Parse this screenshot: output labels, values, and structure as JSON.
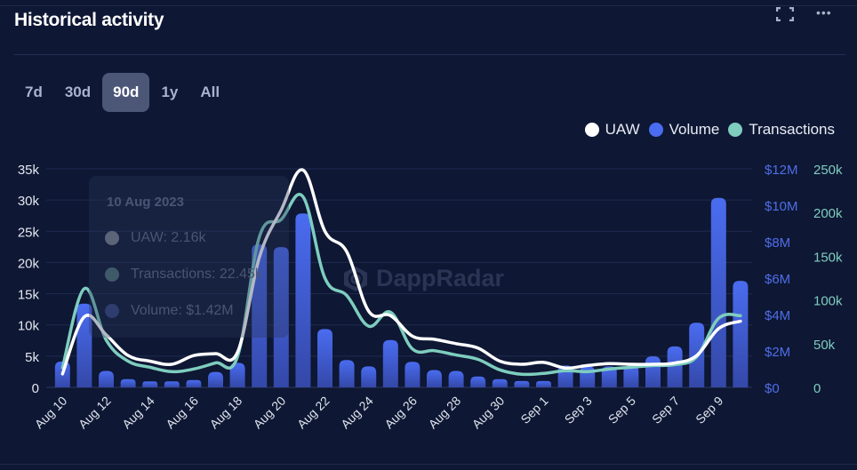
{
  "header": {
    "title": "Historical activity",
    "expand_icon": "expand-icon",
    "more_icon": "more-horizontal-icon"
  },
  "tabs": [
    {
      "label": "7d",
      "active": false
    },
    {
      "label": "30d",
      "active": false
    },
    {
      "label": "90d",
      "active": true
    },
    {
      "label": "1y",
      "active": false
    },
    {
      "label": "All",
      "active": false
    }
  ],
  "legend": [
    {
      "label": "UAW",
      "color": "#ffffff"
    },
    {
      "label": "Volume",
      "color": "#4a6cf0"
    },
    {
      "label": "Transactions",
      "color": "#7ecdbf"
    }
  ],
  "tooltip": {
    "date": "10 Aug 2023",
    "uaw": "UAW: 2.16k",
    "transactions": "Transactions: 22.45k",
    "volume": "Volume: $1.42M"
  },
  "watermark": "DappRadar",
  "chart_data": {
    "type": "bar+line",
    "categories": [
      "Aug 10",
      "Aug 11",
      "Aug 12",
      "Aug 13",
      "Aug 14",
      "Aug 15",
      "Aug 16",
      "Aug 17",
      "Aug 18",
      "Aug 19",
      "Aug 20",
      "Aug 21",
      "Aug 22",
      "Aug 23",
      "Aug 24",
      "Aug 25",
      "Aug 26",
      "Aug 27",
      "Aug 28",
      "Aug 29",
      "Aug 30",
      "Aug 31",
      "Sep 1",
      "Sep 2",
      "Sep 3",
      "Sep 4",
      "Sep 5",
      "Sep 6",
      "Sep 7",
      "Sep 8",
      "Sep 9",
      "Sep 10"
    ],
    "x_tick_labels": [
      "Aug 10",
      "Aug 12",
      "Aug 14",
      "Aug 16",
      "Aug 18",
      "Aug 20",
      "Aug 22",
      "Aug 24",
      "Aug 26",
      "Aug 28",
      "Aug 30",
      "Sep 1",
      "Sep 3",
      "Sep 5",
      "Sep 7",
      "Sep 9"
    ],
    "series": [
      {
        "name": "UAW",
        "type": "line",
        "axis": "left",
        "unit": "k",
        "color": "#ffffff",
        "values": [
          2.16,
          11.3,
          8.4,
          5.1,
          4.2,
          3.7,
          5.1,
          5.4,
          5.6,
          20.8,
          28.4,
          34.8,
          25,
          21.7,
          12.2,
          11.5,
          8.2,
          7.7,
          7.0,
          6.3,
          4.2,
          3.7,
          4.0,
          3.1,
          3.5,
          3.8,
          3.7,
          3.7,
          3.9,
          5.1,
          9.4,
          10.6
        ]
      },
      {
        "name": "Volume",
        "type": "bar",
        "axis": "right1",
        "unit": "$M",
        "color": "#4a6cf0",
        "values": [
          1.42,
          4.6,
          0.9,
          0.45,
          0.33,
          0.33,
          0.4,
          0.85,
          1.35,
          7.85,
          7.7,
          9.55,
          3.2,
          1.5,
          1.15,
          2.6,
          1.4,
          0.95,
          0.9,
          0.6,
          0.45,
          0.35,
          0.35,
          1.2,
          1.15,
          1.15,
          1.2,
          1.7,
          2.25,
          3.55,
          10.4,
          5.85
        ]
      },
      {
        "name": "Transactions",
        "type": "line",
        "axis": "right2",
        "unit": "k",
        "color": "#7ecdbf",
        "values": [
          22.45,
          113,
          54,
          30,
          23,
          18,
          21,
          28,
          35,
          172,
          192,
          218,
          125,
          105,
          70,
          86,
          44,
          42,
          37,
          32,
          20,
          15,
          16,
          19,
          18,
          21,
          23,
          25,
          26,
          35,
          79,
          82
        ]
      }
    ],
    "y_left": {
      "ticks": [
        "0",
        "5k",
        "10k",
        "15k",
        "20k",
        "25k",
        "30k",
        "35k"
      ],
      "range": [
        0,
        35
      ]
    },
    "y_right1": {
      "ticks": [
        "$0",
        "$2M",
        "$4M",
        "$6M",
        "$8M",
        "$10M",
        "$12M"
      ],
      "range": [
        0,
        12
      ]
    },
    "y_right2": {
      "ticks": [
        "0",
        "50k",
        "100k",
        "150k",
        "200k",
        "250k"
      ],
      "range": [
        0,
        250
      ]
    },
    "grid": true,
    "legend_position": "top-right"
  }
}
